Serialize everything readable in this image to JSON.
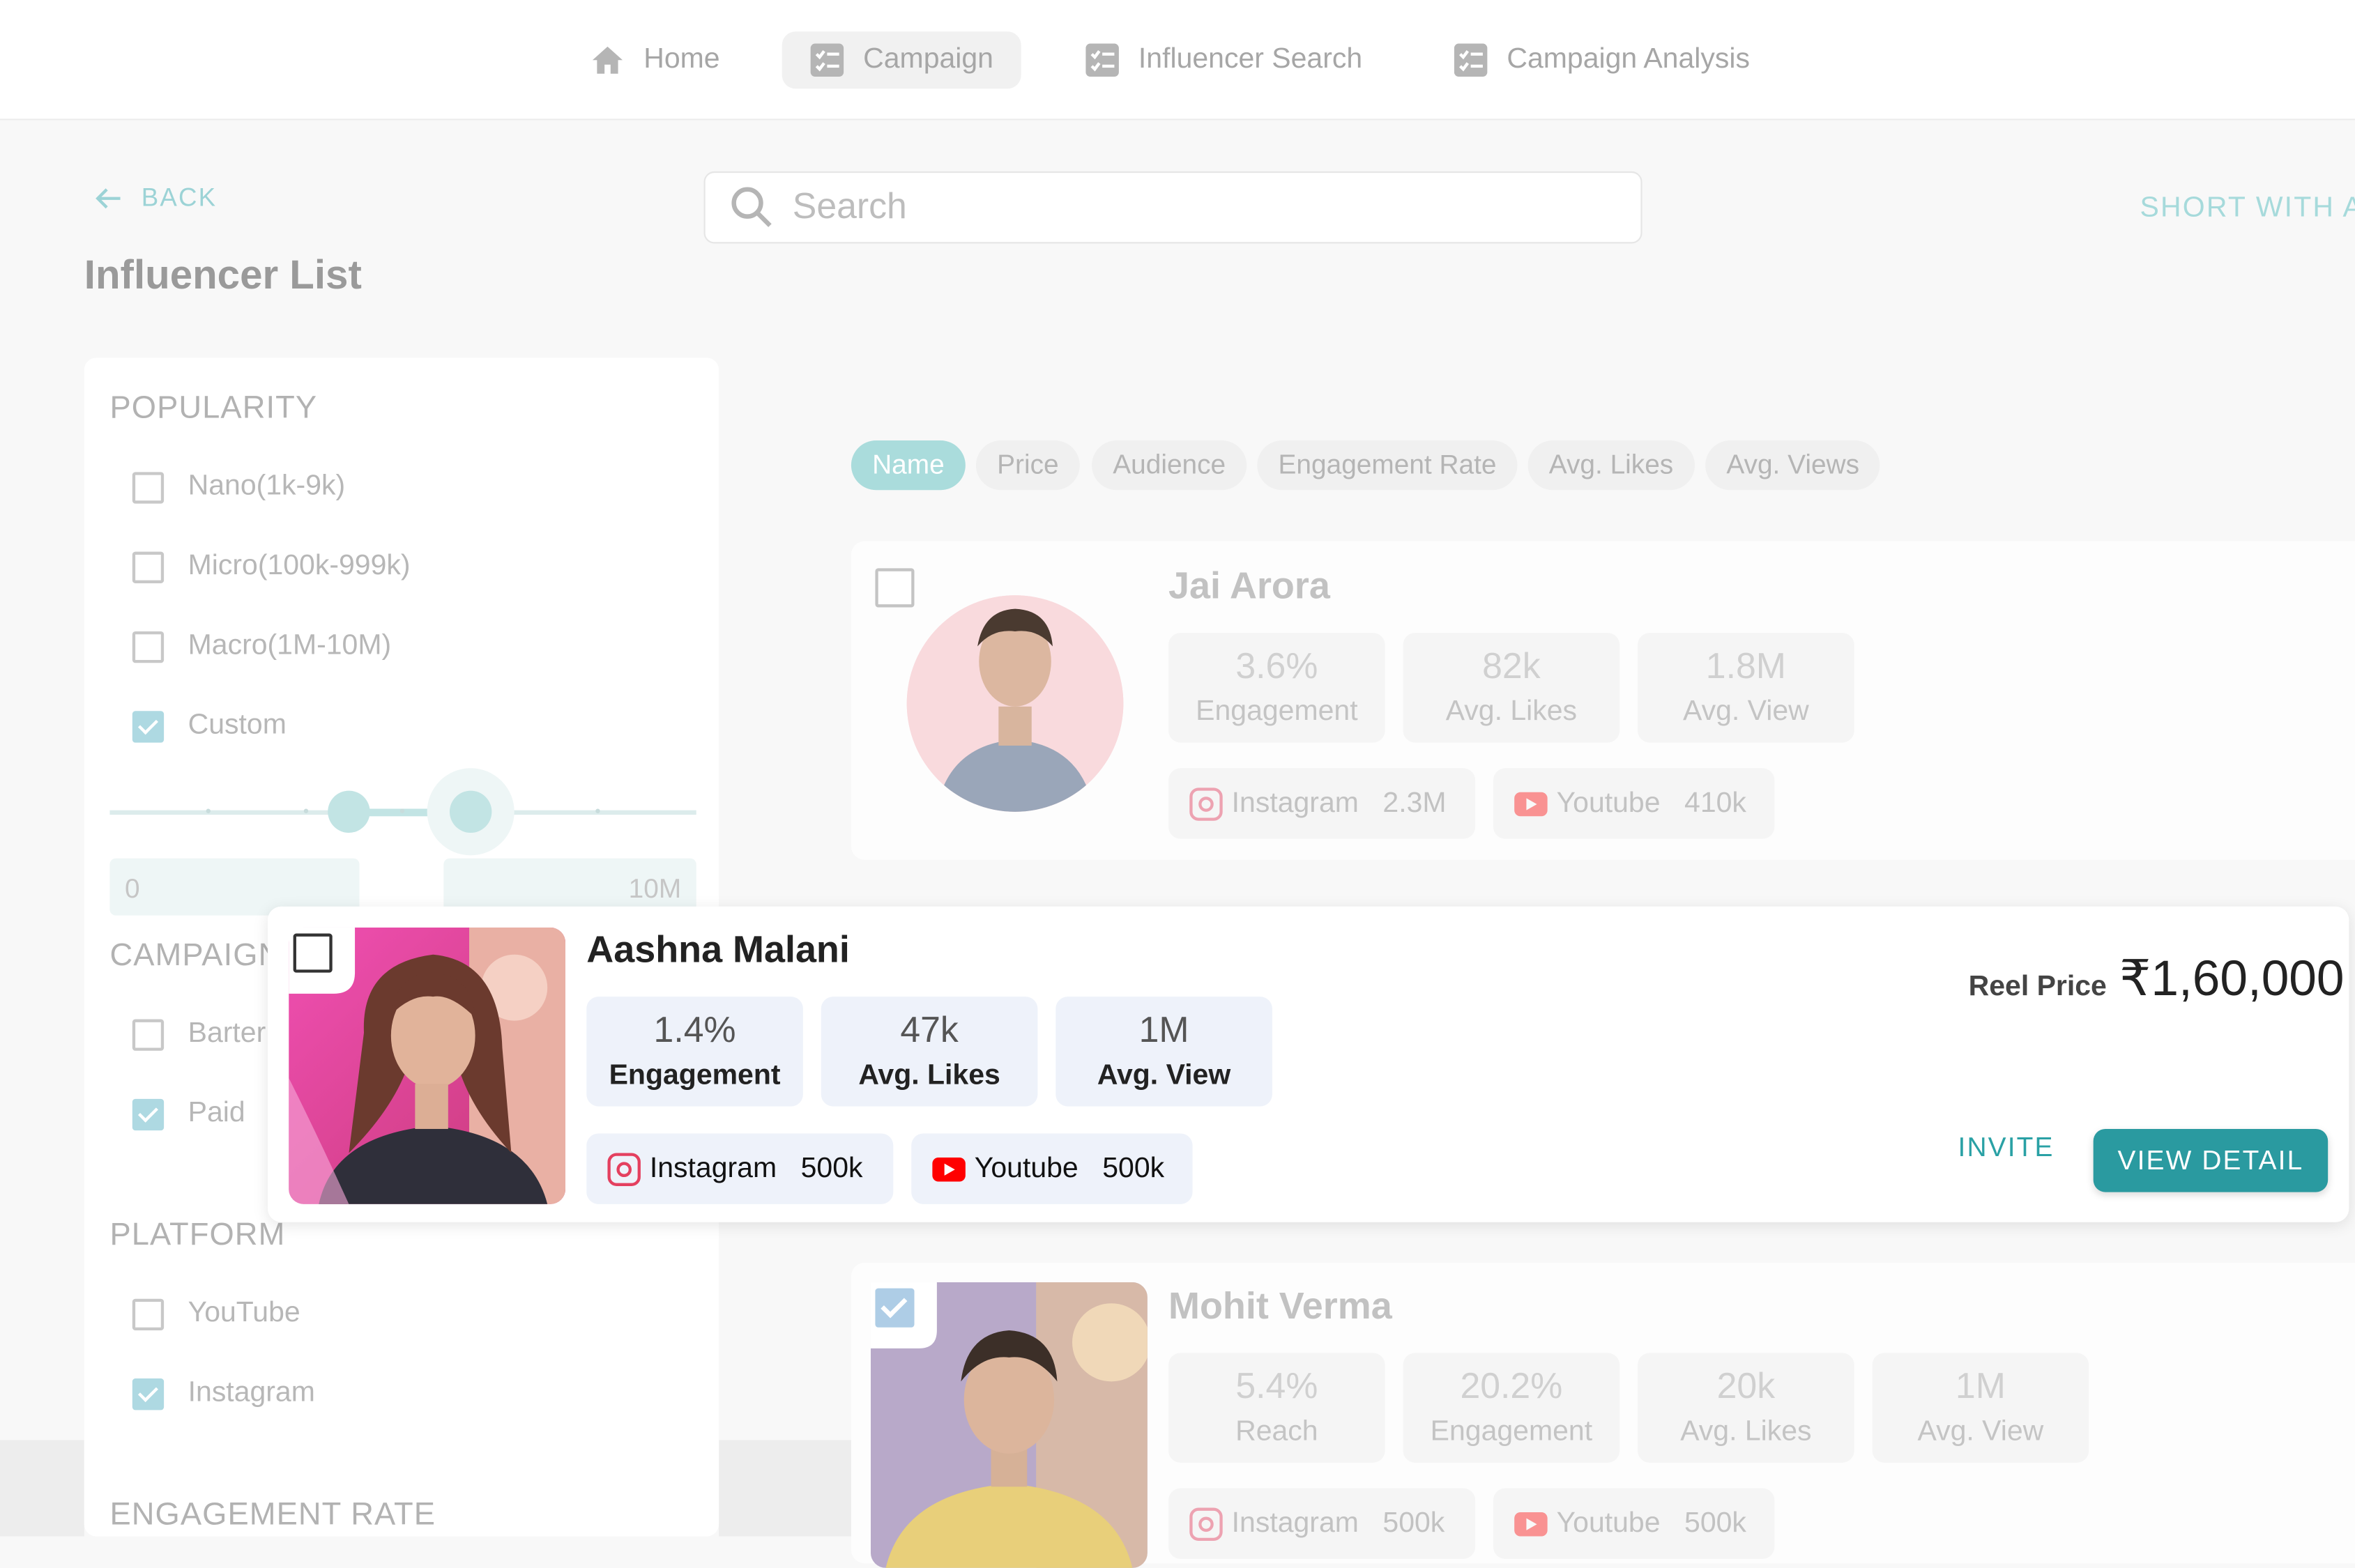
{
  "nav": {
    "items": [
      {
        "label": "Home",
        "icon": "home-icon"
      },
      {
        "label": "Campaign",
        "icon": "checklist-icon",
        "active": true
      },
      {
        "label": "Influencer Search",
        "icon": "checklist-icon"
      },
      {
        "label": "Campaign Analysis",
        "icon": "checklist-icon"
      }
    ]
  },
  "back_label": "BACK",
  "page_title": "Influencer List",
  "search": {
    "placeholder": "Search"
  },
  "short_with": "SHORT  WITH A",
  "filters": {
    "popularity": {
      "title": "POPULARITY",
      "options": [
        {
          "label": "Nano(1k-9k)",
          "checked": false
        },
        {
          "label": "Micro(100k-999k)",
          "checked": false
        },
        {
          "label": "Macro(1M-10M)",
          "checked": false
        },
        {
          "label": "Custom",
          "checked": true
        }
      ],
      "range": {
        "min": "0",
        "max": "10M"
      }
    },
    "campaign": {
      "title": "CAMPAIGN",
      "options": [
        {
          "label": "Barter",
          "checked": false
        },
        {
          "label": "Paid",
          "checked": true
        }
      ]
    },
    "platform": {
      "title": "PLATFORM",
      "options": [
        {
          "label": "YouTube",
          "checked": false
        },
        {
          "label": "Instagram",
          "checked": true
        }
      ]
    },
    "engagement_title": "ENGAGEMENT RATE"
  },
  "sort_chips": [
    {
      "label": "Name",
      "active": true
    },
    {
      "label": "Price"
    },
    {
      "label": "Audience"
    },
    {
      "label": "Engagement Rate"
    },
    {
      "label": "Avg. Likes"
    },
    {
      "label": "Avg. Views"
    }
  ],
  "influencers": [
    {
      "name": "Jai Arora",
      "selected": false,
      "stats": [
        {
          "value": "3.6%",
          "label": "Engagement"
        },
        {
          "value": "82k",
          "label": "Avg. Likes"
        },
        {
          "value": "1.8M",
          "label": "Avg. View"
        }
      ],
      "platforms": [
        {
          "name": "Instagram",
          "value": "2.3M",
          "icon": "instagram-icon"
        },
        {
          "name": "Youtube",
          "value": "410k",
          "icon": "youtube-icon"
        }
      ]
    },
    {
      "name": "Aashna Malani",
      "selected": false,
      "stats": [
        {
          "value": "1.4%",
          "label": "Engagement"
        },
        {
          "value": "47k",
          "label": "Avg. Likes"
        },
        {
          "value": "1M",
          "label": "Avg. View"
        }
      ],
      "platforms": [
        {
          "name": "Instagram",
          "value": "500k",
          "icon": "instagram-icon"
        },
        {
          "name": "Youtube",
          "value": "500k",
          "icon": "youtube-icon"
        }
      ],
      "reel_price_label": "Reel Price",
      "reel_price": "₹1,60,000",
      "invite_label": "INVITE",
      "view_detail_label": "VIEW DETAIL"
    },
    {
      "name": "Mohit Verma",
      "selected": true,
      "stats": [
        {
          "value": "5.4%",
          "label": "Reach"
        },
        {
          "value": "20.2%",
          "label": "Engagement"
        },
        {
          "value": "20k",
          "label": "Avg. Likes"
        },
        {
          "value": "1M",
          "label": "Avg. View"
        }
      ],
      "platforms": [
        {
          "name": "Instagram",
          "value": "500k",
          "icon": "instagram-icon"
        },
        {
          "name": "Youtube",
          "value": "500k",
          "icon": "youtube-icon"
        }
      ]
    }
  ],
  "colors": {
    "accent": "#2a9aa0",
    "accent_light": "#aadcdc",
    "instagram": "#e4405f",
    "youtube": "#ff0000"
  }
}
